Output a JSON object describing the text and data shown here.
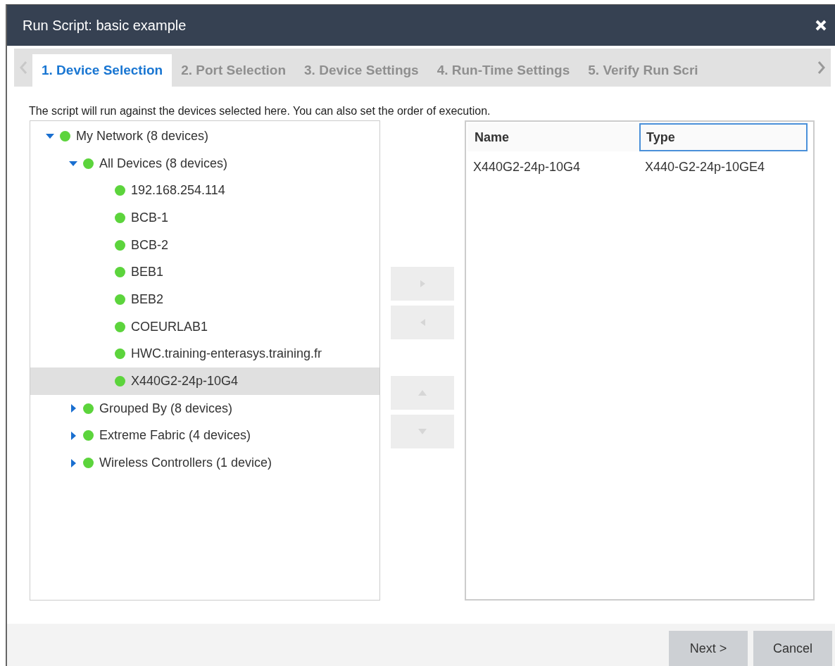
{
  "window": {
    "title": "Run Script: basic example"
  },
  "tabs": [
    {
      "label": "1. Device Selection",
      "selected": true
    },
    {
      "label": "2. Port Selection",
      "selected": false
    },
    {
      "label": "3. Device Settings",
      "selected": false
    },
    {
      "label": "4. Run-Time Settings",
      "selected": false
    },
    {
      "label": "5. Verify Run Scri",
      "selected": false
    }
  ],
  "description": "The script will run against the devices selected here. You can also set the order of execution.",
  "tree": [
    {
      "label": "My Network (8 devices)",
      "expanded": true,
      "selected": false,
      "children": [
        {
          "label": "All Devices (8 devices)",
          "expanded": true,
          "selected": false,
          "children": [
            {
              "label": "192.168.254.114",
              "selected": false
            },
            {
              "label": "BCB-1",
              "selected": false
            },
            {
              "label": "BCB-2",
              "selected": false
            },
            {
              "label": "BEB1",
              "selected": false
            },
            {
              "label": "BEB2",
              "selected": false
            },
            {
              "label": "COEURLAB1",
              "selected": false
            },
            {
              "label": "HWC.training-enterasys.training.fr",
              "selected": false
            },
            {
              "label": "X440G2-24p-10G4",
              "selected": true
            }
          ]
        },
        {
          "label": "Grouped By (8 devices)",
          "expanded": false,
          "selected": false
        },
        {
          "label": "Extreme Fabric (4 devices)",
          "expanded": false,
          "selected": false
        },
        {
          "label": "Wireless Controllers (1 device)",
          "expanded": false,
          "selected": false
        }
      ]
    }
  ],
  "transfer_buttons": [
    {
      "kind": "add",
      "disabled": true
    },
    {
      "kind": "remove",
      "disabled": true
    },
    {
      "kind": "up",
      "disabled": true
    },
    {
      "kind": "down",
      "disabled": true
    }
  ],
  "table": {
    "columns": [
      {
        "label": "Name",
        "focused": false
      },
      {
        "label": "Type",
        "focused": true
      }
    ],
    "rows": [
      [
        "X440G2-24p-10G4",
        "X440-G2-24p-10GE4"
      ]
    ]
  },
  "footer": {
    "buttons": [
      {
        "label": "Next >"
      },
      {
        "label": "Cancel"
      }
    ]
  }
}
